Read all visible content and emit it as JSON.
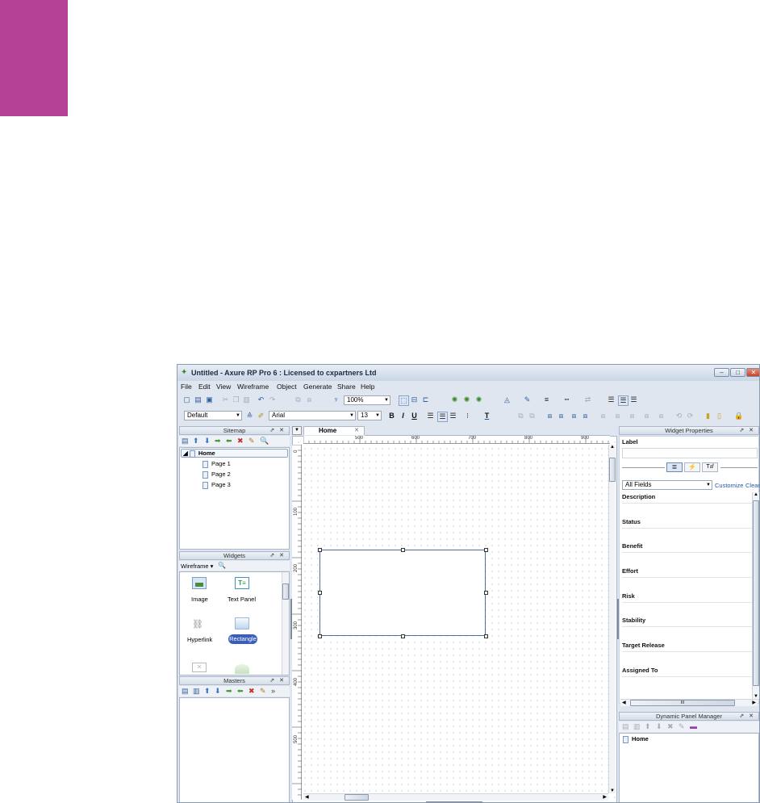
{
  "window": {
    "title": "Untitled - Axure RP Pro 6 : Licensed to cxpartners Ltd",
    "controls": {
      "minimize": "–",
      "maximize": "□",
      "close": "✕"
    }
  },
  "menu": [
    "File",
    "Edit",
    "View",
    "Wireframe",
    "Object",
    "Generate",
    "Share",
    "Help"
  ],
  "toolbar": {
    "zoom": "100%",
    "style": "Default",
    "font": "Arial",
    "font_size": "13",
    "bold": "B",
    "italic": "I",
    "underline": "U",
    "text_color": "T"
  },
  "sitemap": {
    "title": "Sitemap",
    "root": "Home",
    "pages": [
      "Page 1",
      "Page 2",
      "Page 3"
    ]
  },
  "widgets": {
    "title": "Widgets",
    "library": "Wireframe",
    "items": [
      "Image",
      "Text Panel",
      "Hyperlink",
      "Rectangle"
    ]
  },
  "masters": {
    "title": "Masters"
  },
  "canvas": {
    "tab": "Home",
    "ruler_top": [
      "500",
      "600",
      "700",
      "800",
      "900"
    ],
    "ruler_left": [
      "0",
      "100",
      "200",
      "300",
      "400",
      "500"
    ]
  },
  "widget_properties": {
    "title": "Widget Properties",
    "label_heading": "Label",
    "filter": "All Fields",
    "customize": "Customize",
    "clear": "Clear",
    "fields": [
      "Description",
      "Status",
      "Benefit",
      "Effort",
      "Risk",
      "Stability",
      "Target Release",
      "Assigned To"
    ],
    "hscroll_grip": "III"
  },
  "dynamic_panel_manager": {
    "title": "Dynamic Panel Manager",
    "root": "Home"
  },
  "colors": {
    "accent_block": "#b54197",
    "selection_blue": "#4a6fa5",
    "window_chrome": "#dfe6ef"
  }
}
